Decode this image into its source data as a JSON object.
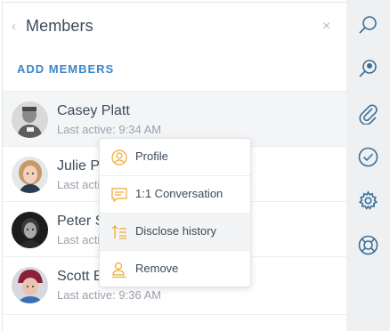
{
  "header": {
    "title": "Members",
    "back_icon": "chevron-left-icon",
    "close_icon": "close-icon"
  },
  "actions": {
    "add_members": "ADD MEMBERS"
  },
  "members": [
    {
      "name": "Casey Platt",
      "status": "Last active: 9:34 AM"
    },
    {
      "name": "Julie Pf",
      "status": "Last activ"
    },
    {
      "name": "Peter S",
      "status": "Last activ"
    },
    {
      "name": "Scott B",
      "status": "Last active: 9:36 AM"
    }
  ],
  "context_menu": {
    "items": [
      {
        "label": "Profile",
        "icon": "user-circle-icon"
      },
      {
        "label": "1:1 Conversation",
        "icon": "chat-bubble-icon"
      },
      {
        "label": "Disclose history",
        "icon": "disclose-history-icon"
      },
      {
        "label": "Remove",
        "icon": "remove-user-icon"
      }
    ],
    "accent_color": "#f0a830"
  },
  "rail": {
    "icons": [
      "search-icon",
      "pin-search-icon",
      "paperclip-icon",
      "checkmark-icon",
      "gear-icon",
      "lifebuoy-icon"
    ],
    "icon_color": "#3a6f98"
  }
}
